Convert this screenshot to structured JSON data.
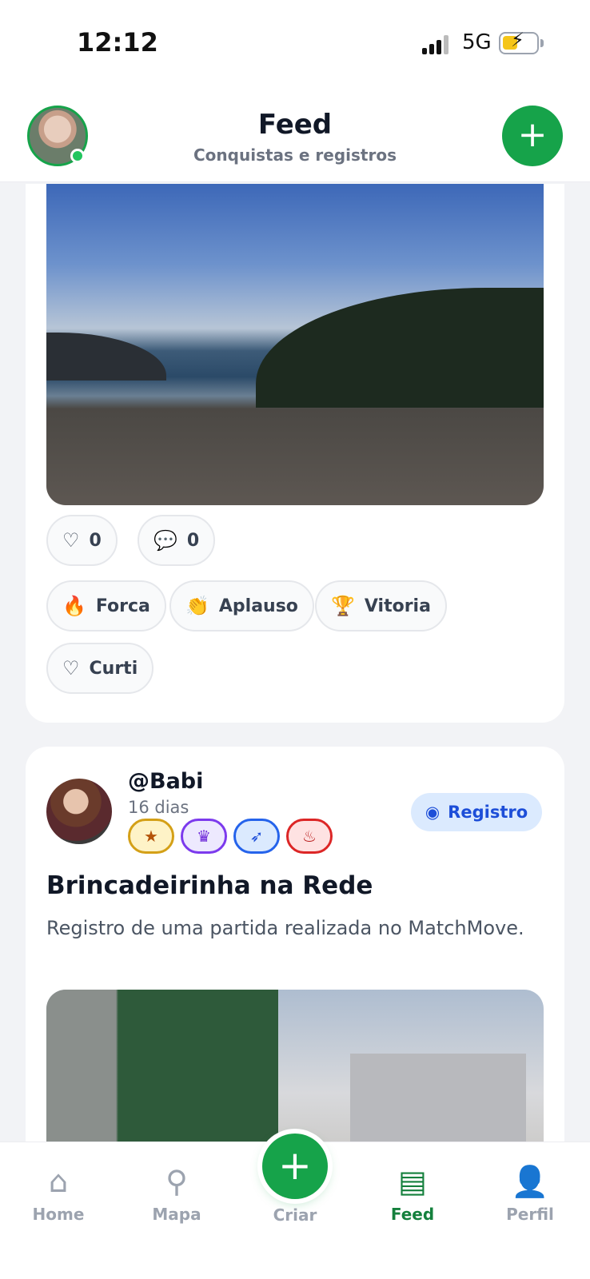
{
  "status_bar": {
    "time": "12:12",
    "network": "5G"
  },
  "header": {
    "title": "Feed",
    "subtitle": "Conquistas e registros",
    "add_label": "+"
  },
  "post1": {
    "likes": "0",
    "comments": "0",
    "reactions": [
      "Forca",
      "Aplauso",
      "Vitoria",
      "Curti"
    ]
  },
  "post2": {
    "username": "@Babi",
    "time_ago": "16 dias",
    "tag": "Registro",
    "title": "Brincadeirinha na Rede",
    "description": "Registro de uma partida realizada no MatchMove.",
    "badges": [
      {
        "icon": "star-icon",
        "color": "#d4a017"
      },
      {
        "icon": "crown-icon",
        "color": "#7c3aed"
      },
      {
        "icon": "rocket-icon",
        "color": "#2563eb"
      },
      {
        "icon": "flame-icon",
        "color": "#dc2626"
      }
    ]
  },
  "nav": {
    "home": "Home",
    "map": "Mapa",
    "create": "Criar",
    "feed": "Feed",
    "profile": "Perfil"
  },
  "colors": {
    "accent": "#16a34a",
    "tag_bg": "#dbeafe",
    "tag_text": "#1d4ed8"
  }
}
